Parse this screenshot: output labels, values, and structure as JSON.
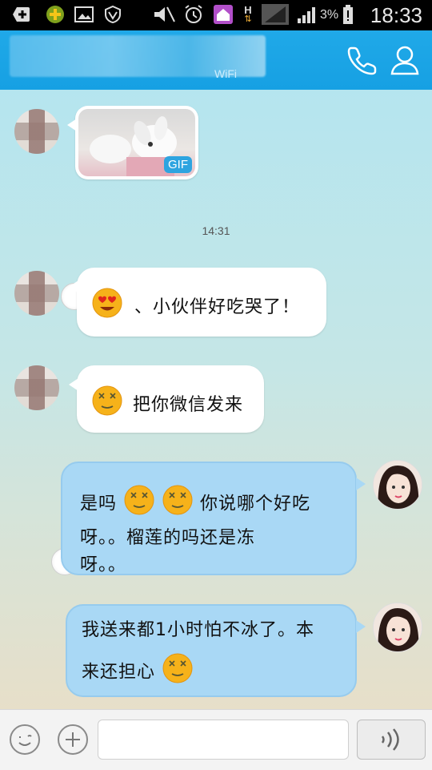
{
  "status_bar": {
    "time": "18:33",
    "battery_percent": "3%",
    "network_indicator": "H",
    "icons": [
      "plus-icon",
      "app-icon",
      "image-icon",
      "vpn-icon",
      "mute-icon",
      "alarm-icon",
      "home-icon",
      "network-icon",
      "signal-icon",
      "battery-icon"
    ]
  },
  "header": {
    "subtitle": "WiFi",
    "icons": [
      "phone-icon",
      "person-icon"
    ]
  },
  "messages": {
    "m1": {
      "type": "gif",
      "badge": "GIF"
    },
    "timestamp": "14:31",
    "m2": {
      "text": "、小伙伴好吃哭了！",
      "emoji": "heart-eyes-emoji"
    },
    "m3": {
      "text": "把你微信发来",
      "emoji": "dizzy-emoji"
    },
    "m4": {
      "line1_a": "是吗",
      "line1_b": "你说哪个好吃",
      "line2": "呀。。榴莲的吗还是冻",
      "line3": "呀。。",
      "emoji": "dizzy-emoji"
    },
    "m5": {
      "line1": "我送来都1小时怕不冰了。本",
      "line2": "来还担心",
      "emoji": "dizzy-emoji"
    }
  },
  "bottom_bar": {
    "input_value": "",
    "icons": [
      "emoji-icon",
      "plus-icon",
      "voice-icon"
    ]
  },
  "colors": {
    "header": "#16a0e3",
    "incoming_bubble": "#ffffff",
    "outgoing_bubble": "#a9d8f5"
  }
}
